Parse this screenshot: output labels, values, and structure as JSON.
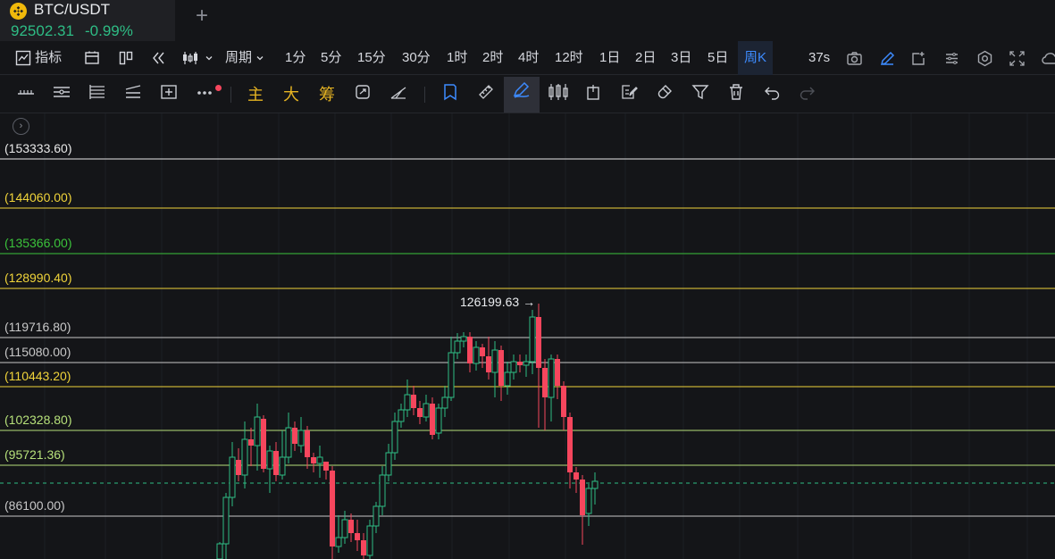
{
  "symbol": {
    "name": "BTC/USDT",
    "price": "92502.31",
    "change": "-0.99%",
    "add_tab": "+"
  },
  "toolbar": {
    "indicators_label": "指标",
    "period_label": "周期",
    "periods": [
      "1分",
      "5分",
      "15分",
      "30分",
      "1时",
      "2时",
      "4时",
      "12时",
      "1日",
      "2日",
      "3日",
      "5日",
      "周K"
    ],
    "active_period": "周K",
    "countdown": "37s"
  },
  "drawing_toolbar": {
    "main_label": "主",
    "big_label": "大",
    "chip_label": "筹"
  },
  "chart": {
    "peak_label": "126199.63 →",
    "levels": [
      {
        "label": "(153333.60)",
        "color": "#e8e8e8"
      },
      {
        "label": "(144060.00)",
        "color": "#f0d43a"
      },
      {
        "label": "(135366.00)",
        "color": "#3bc23b"
      },
      {
        "label": "(128990.40)",
        "color": "#f0d43a"
      },
      {
        "label": "(119716.80)",
        "color": "#c8c8c8"
      },
      {
        "label": "(115080.00)",
        "color": "#c8c8c8"
      },
      {
        "label": "(110443.20)",
        "color": "#f0d43a"
      },
      {
        "label": "(102328.80)",
        "color": "#b6e07a"
      },
      {
        "label": "(95721.36)",
        "color": "#b6e07a"
      },
      {
        "label": "(86100.00)",
        "color": "#c8c8c8"
      }
    ],
    "up_color": "#2ebd85",
    "down_color": "#f6465d"
  }
}
